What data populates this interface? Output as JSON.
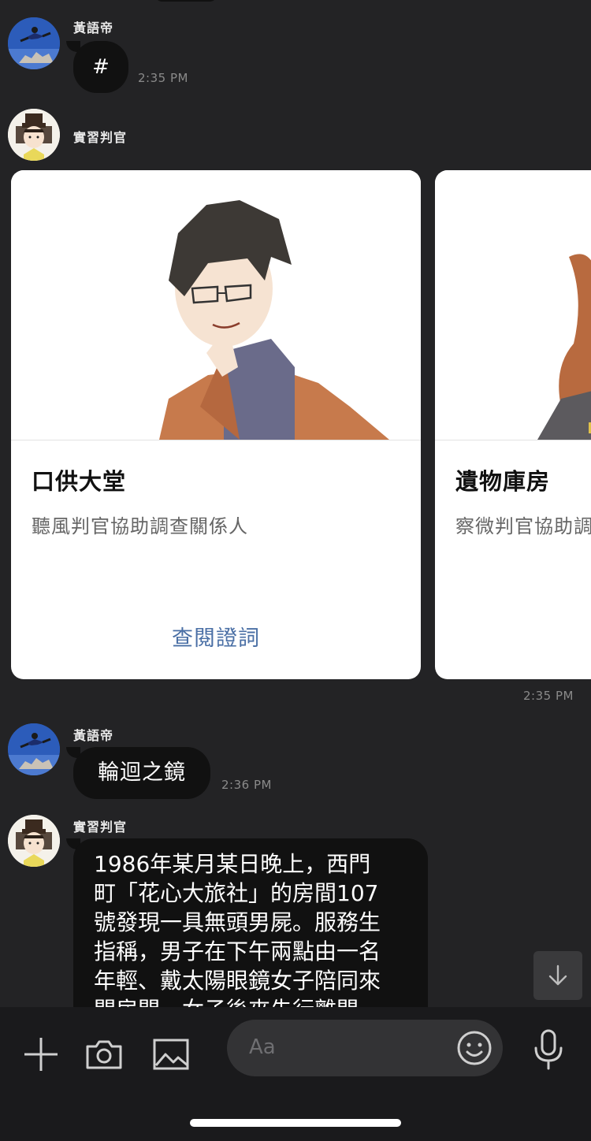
{
  "messages": [
    {
      "sender": "黃語帝",
      "text": "#",
      "time": "2:35 PM"
    },
    {
      "sender": "實習判官"
    },
    {
      "sender": "黃語帝",
      "text": "輪迴之鏡",
      "time": "2:36 PM"
    },
    {
      "sender": "實習判官",
      "lines": [
        "1986年某月某日晚上，西門",
        "町「花心大旅社」的房間107",
        "號發現一具無頭男屍。服務生",
        "指稱，男子在下午兩點由一名",
        "年輕、戴太陽眼鏡女子陪同來",
        "開房間，女子後來先行離開"
      ]
    }
  ],
  "carousel": {
    "time": "2:35 PM",
    "cards": [
      {
        "title": "口供大堂",
        "subtitle": "聽風判官協助調查關係人",
        "action": "查閱證詞"
      },
      {
        "title": "遺物庫房",
        "subtitle": "察微判官協助調"
      }
    ]
  },
  "composer": {
    "placeholder": "Aa",
    "icons": [
      "plus-icon",
      "camera-icon",
      "image-icon",
      "emoji-icon",
      "microphone-icon"
    ]
  },
  "colors": {
    "background": "#232325",
    "bubble": "#111111",
    "action_link": "#4a6fa5"
  }
}
